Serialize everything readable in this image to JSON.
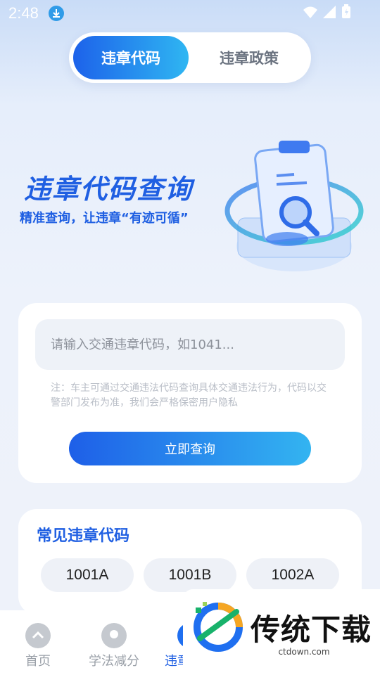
{
  "status_bar": {
    "time": "2:48"
  },
  "tabs": [
    {
      "label": "违章代码",
      "active": true
    },
    {
      "label": "违章政策",
      "active": false
    }
  ],
  "hero": {
    "title": "违章代码查询",
    "subtitle": "精准查询，让违章“有迹可循”"
  },
  "search": {
    "placeholder": "请输入交通违章代码，如1041...",
    "value": "",
    "note": "注：车主可通过交通违法代码查询具体交通违法行为，代码以交警部门发布为准，我们会严格保密用户隐私",
    "button_label": "立即查询"
  },
  "common_codes": {
    "title": "常见违章代码",
    "codes": [
      "1001A",
      "1001B",
      "1002A"
    ]
  },
  "bottom_nav": [
    {
      "label": "首页",
      "icon": "up-arrow-icon"
    },
    {
      "label": "学法减分",
      "icon": "badge-icon"
    },
    {
      "label": "违章代码",
      "icon": "code-icon",
      "active": true
    }
  ],
  "watermark": {
    "text": "传统下载",
    "url": "ctdown.com"
  },
  "colors": {
    "primary": "#1f5fe2",
    "accent": "#2fb6f2",
    "muted": "#9aa0a8"
  }
}
